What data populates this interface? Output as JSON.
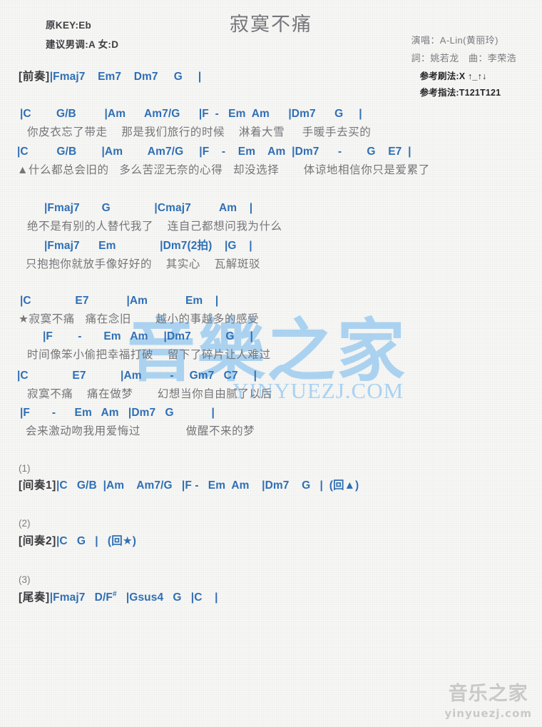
{
  "title": "寂寞不痛",
  "key_info": {
    "original_key": "原KEY:Eb",
    "suggested_key": "建议男调:A 女:D"
  },
  "credits": {
    "singer": "演唱：A-Lin(黄丽玲)",
    "writers": "詞：姚若龙　曲：李荣浩",
    "strumming": "参考刷法:X ↑_↑↓",
    "fingering": "参考指法:T121T121"
  },
  "watermarks": {
    "center_glyphs": "音樂之家",
    "center_domain": "YINYUEZJ.COM",
    "bottom_cn": "音乐之家",
    "bottom_en": "yinyuezj.com"
  },
  "sections": {
    "intro": {
      "label": "[前奏]",
      "chords": "|Fmaj7    Em7    Dm7     G     |"
    },
    "verse1": {
      "chords_1": "|C        G/B         |Am      Am7/G      |F  -   Em  Am      |Dm7      G     |",
      "lyrics_1": "你皮衣忘了带走    那是我们旅行的时候    淋着大雪     手暖手去买的",
      "chords_2": "|C         G/B        |Am        Am7/G     |F    -    Em    Am  |Dm7      -        G    E7  |",
      "lyrics_2": "▲什么都总会旧的   多么苦涩无奈的心得   却没选择       体谅地相信你只是爱累了"
    },
    "prechorus": {
      "chords_1": "|Fmaj7       G              |Cmaj7         Am    |",
      "lyrics_1": "绝不是有别的人替代我了    连自己都想问我为什么",
      "chords_2": "|Fmaj7      Em              |Dm7(2拍)    |G    |",
      "lyrics_2": "只抱抱你就放手像好好的    其实心    瓦解斑驳"
    },
    "chorus": {
      "chords_1": "|C              E7            |Am            Em    |",
      "lyrics_1": "★寂寞不痛   痛在念旧       越小的事越多的感受",
      "chords_2": "|F        -       Em   Am     |Dm7           G     |",
      "lyrics_2": "时间像笨小偷把幸福打破    留下了碎片让人难过",
      "chords_3": "|C              E7           |Am         -     Gm7   C7     |",
      "lyrics_3": "寂寞不痛    痛在做梦       幻想当你自由腻了以后",
      "chords_4": "|F       -      Em   Am   |Dm7   G            |",
      "lyrics_4": "会来激动吻我用爱悔过             做醒不来的梦"
    },
    "interlude1": {
      "number": "(1)",
      "label": "[间奏1]",
      "chords": "|C   G/B  |Am    Am7/G   |F -   Em  Am    |Dm7    G   |  (回▲)"
    },
    "interlude2": {
      "number": "(2)",
      "label": "[间奏2]",
      "chords": "|C   G   |   (回★)"
    },
    "outro": {
      "number": "(3)",
      "label": "[尾奏]",
      "chords_pre": "|Fmaj7   D/F",
      "chords_sharp": "#",
      "chords_post": "   |Gsus4   G   |C    |"
    }
  }
}
